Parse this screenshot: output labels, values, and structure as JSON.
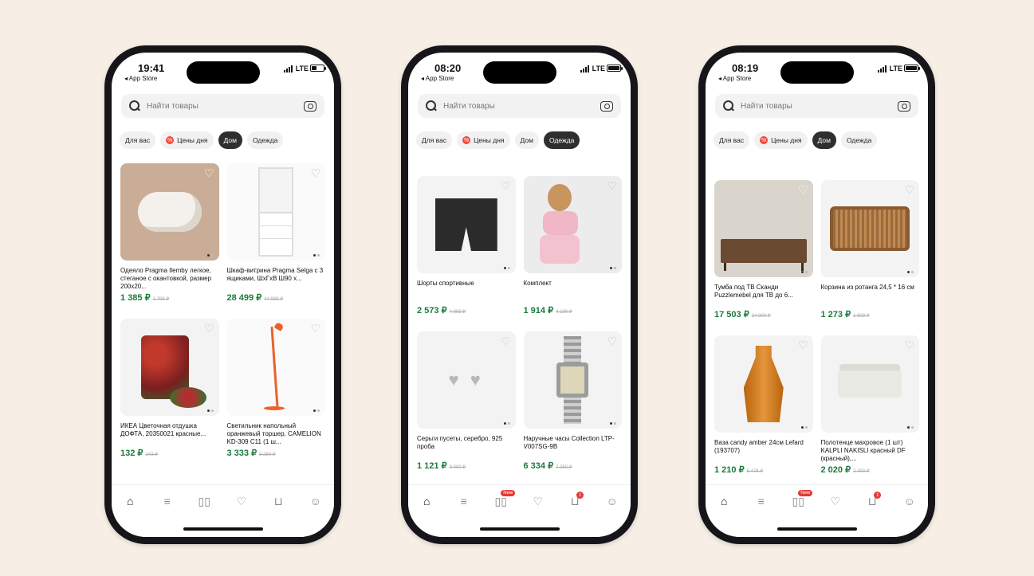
{
  "app": {
    "back_label": "◂ App Store",
    "search_placeholder": "Найти товары",
    "chips": [
      "Для вас",
      "Цены дня",
      "Дом",
      "Одежда"
    ],
    "tab_new_badge": "New",
    "tab_cart_badge": "1"
  },
  "phones": [
    {
      "time": "19:41",
      "carrier": "LTE",
      "active_chip": "Дом",
      "products": [
        {
          "name": "Одеяло Pragma Ilemby легкое, стеганое с окантовкой, размер 200х20...",
          "price": "1 385 ₽",
          "old": "1 799 ₽"
        },
        {
          "name": "Шкаф-витрина Pragma Selga с 3 ящиками, ШхГхВ Ш90 х...",
          "price": "28 499 ₽",
          "old": "44 999 ₽"
        },
        {
          "name": "ИКЕА Цветочная отдушка ДОФТА, 20350021 красные...",
          "price": "132 ₽",
          "old": "143 ₽"
        },
        {
          "name": "Светильник напольный оранжевый торшер, CAMELION KD-309 C11 (1 ш...",
          "price": "3 333 ₽",
          "old": "5 280 ₽"
        }
      ]
    },
    {
      "time": "08:20",
      "carrier": "LTE",
      "active_chip": "Одежда",
      "products": [
        {
          "name": "Шорты спортивные",
          "price": "2 573 ₽",
          "old": "4 999 ₽"
        },
        {
          "name": "Комплект",
          "price": "1 914 ₽",
          "old": "4 199 ₽"
        },
        {
          "name": "Серьги пусеты, серебро, 925 проба",
          "price": "1 121 ₽",
          "old": "3 000 ₽"
        },
        {
          "name": "Наручные часы Collection LTP-V007SG-9B",
          "price": "6 334 ₽",
          "old": "7 250 ₽"
        }
      ]
    },
    {
      "time": "08:19",
      "carrier": "LTE",
      "active_chip": "Дом",
      "products": [
        {
          "name": "Тумба под ТВ Сканди Puzzlemebel для ТВ до 6...",
          "price": "17 503 ₽",
          "old": "24 900 ₽"
        },
        {
          "name": "Корзина из ротанга 24,5 * 16 см",
          "price": "1 273 ₽",
          "old": "1 809 ₽"
        },
        {
          "name": "Ваза candy amber 24см Lefard (193707)",
          "price": "1 210 ₽",
          "old": "5 476 ₽"
        },
        {
          "name": "Полотенце махровое (1 шт) KALPLI NAKISLI красный DF (красный),...",
          "price": "2 020 ₽",
          "old": "2 400 ₽"
        }
      ]
    }
  ]
}
